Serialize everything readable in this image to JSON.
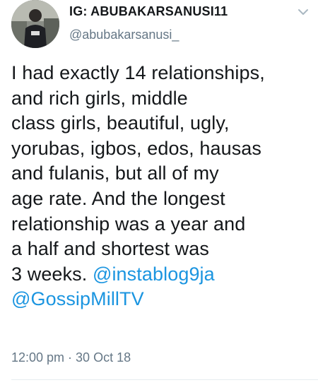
{
  "author": {
    "display_name": "IG: ABUBAKARSANUSI11",
    "handle": "@abubakarsanusi_",
    "avatar_icon": "profile-photo"
  },
  "menu": {
    "icon": "chevron-down-icon"
  },
  "tweet": {
    "lines": [
      "I had exactly 14 relationships,",
      "and rich girls, middle",
      "class girls, beautiful, ugly,",
      "yorubas, igbos, edos, hausas",
      "and fulanis, but all of my",
      "age rate. And the longest",
      "relationship was a year and",
      "a half and shortest was",
      "3 weeks. "
    ],
    "mention_1": "@instablog9ja",
    "mention_2": "@GossipMillTV"
  },
  "meta": {
    "timestamp": "12:00 pm · 30 Oct 18"
  },
  "colors": {
    "text": "#14171a",
    "secondary": "#657786",
    "link": "#1b95e0",
    "divider": "#e6ecf0"
  }
}
